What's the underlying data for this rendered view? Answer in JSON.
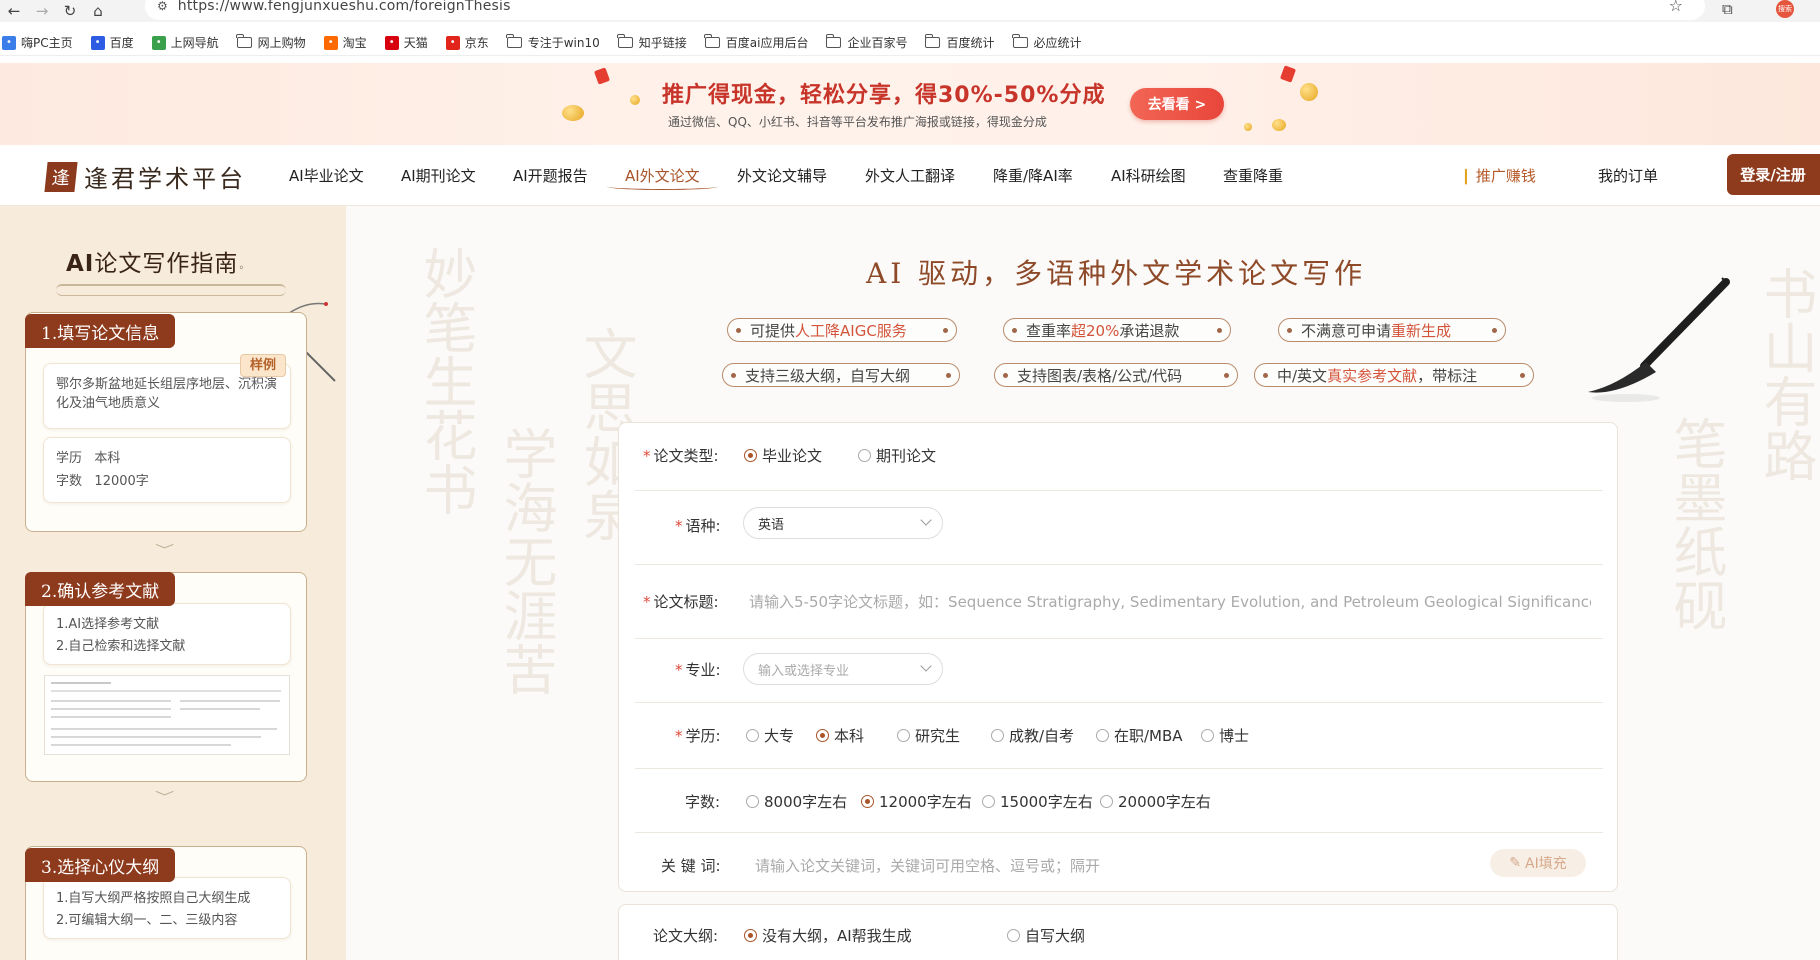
{
  "browser": {
    "url": "https://www.fengjunxueshu.com/foreignThesis",
    "bookmarks": [
      {
        "label": "嗨PC主页",
        "icon": "hipc-icon",
        "color": "#3b7de9"
      },
      {
        "label": "百度",
        "icon": "baidu-icon",
        "color": "#2d5be3"
      },
      {
        "label": "上网导航",
        "icon": "nav-site-icon",
        "color": "#3aa04c"
      },
      {
        "label": "网上购物",
        "icon": "folder-icon"
      },
      {
        "label": "淘宝",
        "icon": "taobao-icon",
        "color": "#ff6a00"
      },
      {
        "label": "天猫",
        "icon": "tmall-icon",
        "color": "#d8000f"
      },
      {
        "label": "京东",
        "icon": "jd-icon",
        "color": "#e1251b"
      },
      {
        "label": "专注于win10",
        "icon": "folder-icon"
      },
      {
        "label": "知乎链接",
        "icon": "folder-icon"
      },
      {
        "label": "百度ai应用后台",
        "icon": "folder-icon"
      },
      {
        "label": "企业百家号",
        "icon": "folder-icon"
      },
      {
        "label": "百度统计",
        "icon": "folder-icon"
      },
      {
        "label": "必应统计",
        "icon": "folder-icon"
      }
    ],
    "profile_label": "搜索"
  },
  "promo": {
    "title": "推广得现金，轻松分享，得30%-50%分成",
    "subtitle": "通过微信、QQ、小红书、抖音等平台发布推广海报或链接，得现金分成",
    "button": "去看看 >"
  },
  "header": {
    "logo_mark": "逢",
    "logo_text": "逢君学术平台",
    "nav": [
      "AI毕业论文",
      "AI期刊论文",
      "AI开题报告",
      "AI外文论文",
      "外文论文辅导",
      "外文人工翻译",
      "降重/降AI率",
      "AI科研绘图",
      "查重降重"
    ],
    "active_nav": "AI外文论文",
    "promo_link": "推广赚钱",
    "orders": "我的订单",
    "login": "登录/注册"
  },
  "sidebar": {
    "title_ai": "AI",
    "title_rest": "论文写作指南",
    "steps": [
      {
        "tag": "1.填写论文信息",
        "badge": "样例",
        "sample_title": "鄂尔多斯盆地延长组层序地层、沉积演化及油气地质意义",
        "edu_label": "学历",
        "edu_value": "本科",
        "words_label": "字数",
        "words_value": "12000字"
      },
      {
        "tag": "2.确认参考文献",
        "lines": [
          "1.AI选择参考文献",
          "2.自己检索和选择文献"
        ]
      },
      {
        "tag": "3.选择心仪大纲",
        "lines": [
          "1.自写大纲严格按照自己大纲生成",
          "2.可编辑大纲一、二、三级内容"
        ]
      }
    ]
  },
  "hero": {
    "title": "AI 驱动，多语种外文学术论文写作",
    "pills": [
      {
        "pre": "可提供",
        "hl": "人工降AIGC服务",
        "post": ""
      },
      {
        "pre": "查重率",
        "hl": "超20%",
        "post": "承诺退款"
      },
      {
        "pre": "不满意可申请",
        "hl": "重新生成",
        "post": ""
      },
      {
        "pre": "支持三级大纲，自写大纲",
        "hl": "",
        "post": ""
      },
      {
        "pre": "支持图表/表格/公式/代码",
        "hl": "",
        "post": ""
      },
      {
        "pre": "中/英文",
        "hl": "真实参考文献",
        "post": "，带标注"
      }
    ]
  },
  "form": {
    "type_label": "论文类型:",
    "type_options": [
      "毕业论文",
      "期刊论文"
    ],
    "type_selected": 0,
    "lang_label": "语种:",
    "lang_value": "英语",
    "title_label": "论文标题:",
    "title_placeholder": "请输入5-50字论文标题，如：Sequence Stratigraphy, Sedimentary Evolution, and Petroleum Geological Significance o",
    "major_label": "专业:",
    "major_placeholder": "输入或选择专业",
    "edu_label": "学历:",
    "edu_options": [
      "大专",
      "本科",
      "研究生",
      "成教/自考",
      "在职/MBA",
      "博士"
    ],
    "edu_selected": 1,
    "words_label": "字数:",
    "words_options": [
      "8000字左右",
      "12000字左右",
      "15000字左右",
      "20000字左右"
    ],
    "words_selected": 1,
    "kw_label": "关 键 词:",
    "kw_placeholder": "请输入论文关键词，关键词可用空格、逗号或；隔开",
    "ai_fill": "AI填充",
    "outline_label": "论文大纲:",
    "outline_options": [
      "没有大纲，AI帮我生成",
      "自写大纲"
    ],
    "outline_selected": 0
  },
  "colors": {
    "brand": "#8e3a1c",
    "accent": "#a8542a",
    "required": "#e0493a",
    "promo_red": "#c7342a"
  }
}
